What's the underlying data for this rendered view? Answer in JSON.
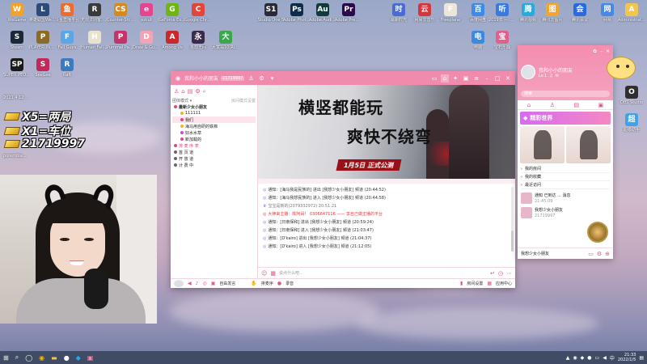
{
  "overlay": {
    "line1": "X5=两局",
    "line2": "X1=车位",
    "line3": "21719997",
    "chat": [
      "2021.4.12 ...",
      "...",
      "...",
      "porembia...",
      "...",
      "..."
    ]
  },
  "desktop_icons": [
    {
      "label": "WeGame",
      "color": "#f0a32a",
      "glyph": "W"
    },
    {
      "label": "英雄联盟WeGame版",
      "color": "#2c4b78",
      "glyph": "L"
    },
    {
      "label": "斗鱼直播平台",
      "color": "#f06a2a",
      "glyph": "鱼"
    },
    {
      "label": "无限法则客户端平台",
      "color": "#3a3a3a",
      "glyph": "R"
    },
    {
      "label": "Counter-Strike Global Off...",
      "color": "#d68a1a",
      "glyph": "CS"
    },
    {
      "label": "ezcut",
      "color": "#e4458d",
      "glyph": "e"
    },
    {
      "label": "GeForce Experience",
      "color": "#6fb514",
      "glyph": "G"
    },
    {
      "label": "Google Chrome",
      "color": "#e1463a",
      "glyph": "C"
    },
    {
      "label": "Steam",
      "color": "#1b2838",
      "glyph": "S"
    },
    {
      "label": "PLAYERUNKNOWN'S BATTLEGROUNDS",
      "color": "#8b6b25",
      "glyph": "P"
    },
    {
      "label": "Fall Guys",
      "color": "#5aa7e6",
      "glyph": "F"
    },
    {
      "label": "Human Fall Flat",
      "color": "#e9e2cf",
      "glyph": "H"
    },
    {
      "label": "Pummel Party",
      "color": "#c4336a",
      "glyph": "P"
    },
    {
      "label": "Draw & Guess",
      "color": "#f4a3b3",
      "glyph": "D"
    },
    {
      "label": "Among Us",
      "color": "#c9282d",
      "glyph": "A"
    },
    {
      "label": "永劫无间",
      "color": "#3b2b4a",
      "glyph": "永"
    },
    {
      "label": "大富翁10(Richm...",
      "color": "#3aa74a",
      "glyph": "大"
    },
    {
      "label": "SUPER PEOPLE CBT",
      "color": "#1a1a1a",
      "glyph": "SP"
    },
    {
      "label": "SeeGee",
      "color": "#c2285a",
      "glyph": "S"
    },
    {
      "label": "Raft",
      "color": "#3d7bbf",
      "glyph": "R"
    },
    {
      "label": "Studio One 5",
      "color": "#2a2a36",
      "glyph": "S1"
    },
    {
      "label": "Adobe Photosh...",
      "color": "#0f2b4a",
      "glyph": "Ps"
    },
    {
      "label": "Adobe Audition ...",
      "color": "#0f3b3a",
      "glyph": "Au"
    },
    {
      "label": "Adobe Premiere P...",
      "color": "#2a0a4a",
      "glyph": "Pr"
    },
    {
      "label": "最新时光",
      "color": "#4a6ad4",
      "glyph": "时"
    },
    {
      "label": "网易云音乐",
      "color": "#d8343c",
      "glyph": "云"
    },
    {
      "label": "Freeplane",
      "color": "#ece6d8",
      "glyph": "F"
    },
    {
      "label": "百度网盘",
      "color": "#3d8ae8",
      "glyph": "百"
    },
    {
      "label": "2019年 — 听歌...",
      "color": "#3a7ae0",
      "glyph": "听"
    },
    {
      "label": "腾讯视频",
      "color": "#2aa8e0",
      "glyph": "腾"
    },
    {
      "label": "腾讯云图片",
      "color": "#f4a52a",
      "glyph": "图"
    },
    {
      "label": "腾讯会议",
      "color": "#2a6ae0",
      "glyph": "会"
    },
    {
      "label": "网易",
      "color": "#4a88e8",
      "glyph": "网"
    },
    {
      "label": "Administrator",
      "color": "#f0c74a",
      "glyph": "A"
    },
    {
      "label": "电脑",
      "color": "#3a8ae0",
      "glyph": "电"
    },
    {
      "label": "宝石乐翻",
      "color": "#e0608a",
      "glyph": "宝"
    },
    {
      "label": "OBS Studio",
      "color": "#302e31",
      "glyph": "O"
    },
    {
      "label": "超级助手",
      "color": "#3ea3e8",
      "glyph": "超"
    }
  ],
  "client": {
    "title": "我和小小的朋友",
    "room_id": "21719997",
    "sidebar": {
      "mode": "团体模式 ▾",
      "hint": "房间模式设置",
      "rows": [
        {
          "text": "最新少女小朋友",
          "color": "#d94a7b",
          "bold": true
        },
        {
          "text": "111111",
          "color": "#f2b32a"
        },
        {
          "text": "我们",
          "color": "#e4458d",
          "sel": true
        },
        {
          "text": "海马用自研的铁棉",
          "color": "#f2b32a"
        },
        {
          "text": "好水水草",
          "color": "#c64ad8"
        },
        {
          "text": "新加载的",
          "color": "#e4458d"
        },
        {
          "text": "排 麦 序 表",
          "color": "#d94a7b"
        },
        {
          "text": "首 页 道",
          "color": "#666"
        },
        {
          "text": "开 放 道",
          "color": "#666"
        },
        {
          "text": "计 费 中",
          "color": "#666"
        }
      ]
    },
    "banner": {
      "headline1": "横竖都能玩",
      "headline2": "爽快不绕弯",
      "date": "1月5日  正式公测"
    },
    "messages": [
      {
        "text": "通知：[海马我是民族的] 进出 [我想少女小朋友] 频道  (20:44:52)",
        "kind": "normal"
      },
      {
        "text": "通知：[海马我想民族的] 进入 [我想少女小朋友] 频道  (20:44:58)",
        "kind": "normal"
      },
      {
        "text": "宝宝是新的(2079332972)  20:51:21",
        "kind": "gray"
      },
      {
        "text": "大神来主播：陈阿哥！ 0306647116 —— 享自己做主播的平台",
        "kind": "red"
      },
      {
        "text": "通知：[日南保和] 进出 [我想少女小朋友] 频道  (20:59:24)",
        "kind": "normal"
      },
      {
        "text": "通知：[日南保和] 进入 [我想少女小朋友] 频道  (21:03:47)",
        "kind": "normal"
      },
      {
        "text": "通知：[D'kairo] 进出 [我想少女小朋友] 频道  (21:04:37)",
        "kind": "normal"
      },
      {
        "text": "通知：[D'kairo] 进入 [我想少女小朋友] 频道  (21:12:05)",
        "kind": "normal"
      }
    ],
    "input_placeholder": "说点什么吧...",
    "footer": {
      "free_speak": "自由发言",
      "mic_order": "排麦序",
      "record": "录音",
      "room_settings": "房间设置",
      "app_center": "应用中心"
    }
  },
  "panel": {
    "username": "我和小小的朋友",
    "level": "Lv.1",
    "search_placeholder": "搜索",
    "banner_title": "精彩世界",
    "list": [
      "我的房间",
      "我的收藏",
      "最近访问"
    ],
    "recent": [
      {
        "title": "通知 已到达 ... 消息",
        "sub": "21:45:09"
      },
      {
        "title": "我想少女小朋友",
        "sub": "21719997"
      }
    ],
    "footer_label": "我想少女小朋友"
  },
  "taskbar": {
    "time": "21:33",
    "date": "2022/1/5"
  },
  "colors": {
    "accent": "#f08bae",
    "accent_dark": "#e05586",
    "notice_blue": "#3a74c8",
    "alert_red": "#e33a3a"
  }
}
